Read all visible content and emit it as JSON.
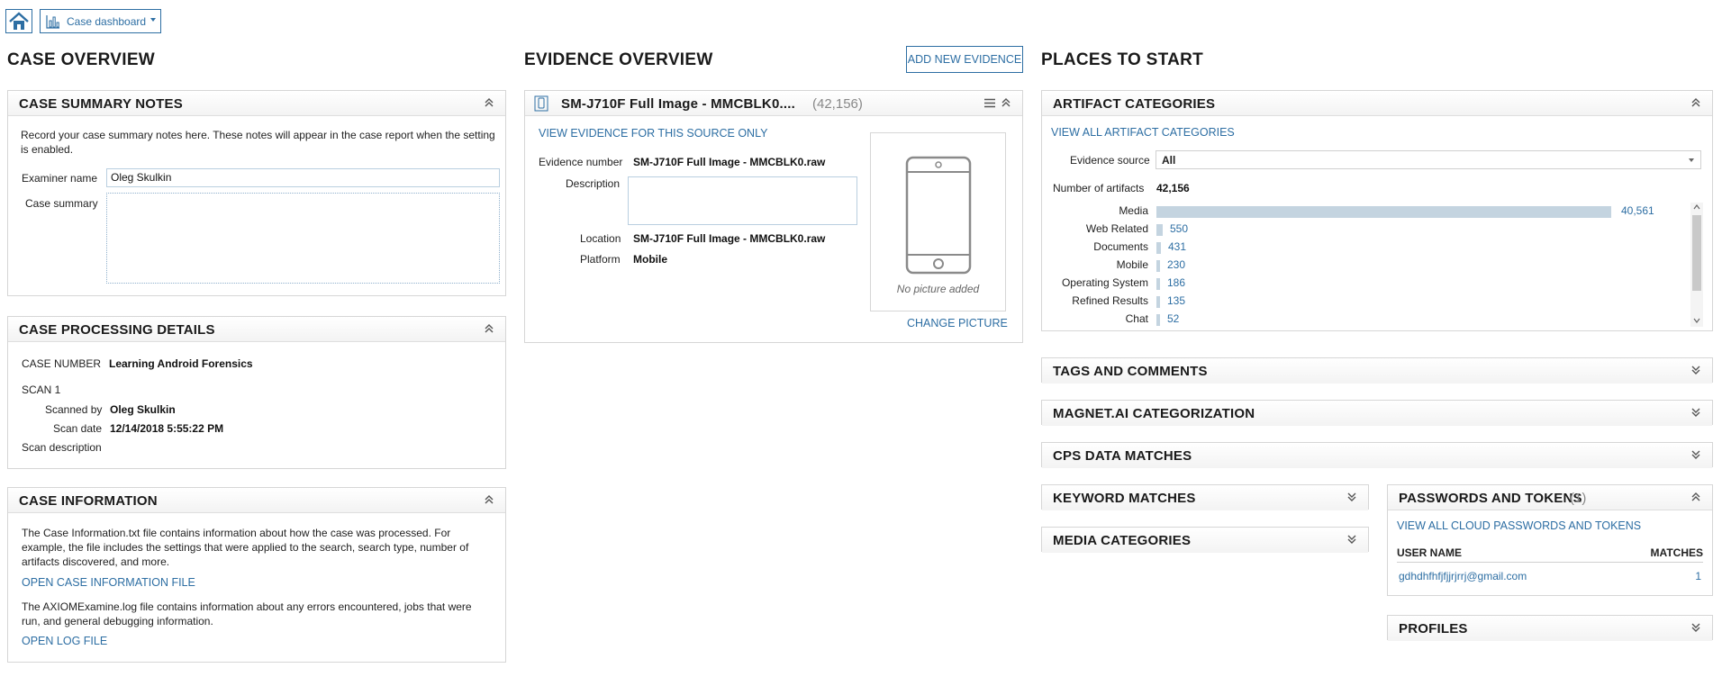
{
  "toolbar": {
    "home_icon": "home-icon",
    "view_selector": {
      "icon": "bar-chart-icon",
      "label": "Case dashboard"
    }
  },
  "case_overview": {
    "title": "CASE OVERVIEW",
    "summary_notes": {
      "title": "CASE SUMMARY NOTES",
      "description": "Record your case summary notes here. These notes will appear in the case report when the setting is enabled.",
      "examiner_label": "Examiner name",
      "examiner_value": "Oleg Skulkin",
      "case_summary_label": "Case summary",
      "case_summary_value": ""
    },
    "processing_details": {
      "title": "CASE PROCESSING DETAILS",
      "case_number_label": "CASE NUMBER",
      "case_number_value": "Learning Android Forensics",
      "scan_heading": "SCAN 1",
      "scanned_by_label": "Scanned by",
      "scanned_by_value": "Oleg Skulkin",
      "scan_date_label": "Scan date",
      "scan_date_value": "12/14/2018 5:55:22 PM",
      "scan_description_label": "Scan description"
    },
    "case_information": {
      "title": "CASE INFORMATION",
      "text1": "The Case Information.txt file contains information about how the case was processed. For example, the file includes the settings that were applied to the search, search type, number of artifacts discovered, and more.",
      "link1": "OPEN CASE INFORMATION FILE",
      "text2": "The AXIOMExamine.log file contains information about any errors encountered, jobs that were run, and general debugging information.",
      "link2": "OPEN LOG FILE"
    }
  },
  "evidence_overview": {
    "title": "EVIDENCE OVERVIEW",
    "add_button": "ADD NEW EVIDENCE",
    "card": {
      "icon": "phone-icon",
      "title": "SM-J710F Full Image - MMCBLK0....",
      "count": "(42,156)",
      "view_link": "VIEW EVIDENCE FOR THIS SOURCE ONLY",
      "evidence_number_label": "Evidence number",
      "evidence_number_value": "SM-J710F Full Image - MMCBLK0.raw",
      "description_label": "Description",
      "description_value": "",
      "location_label": "Location",
      "location_value": "SM-J710F Full Image - MMCBLK0.raw",
      "platform_label": "Platform",
      "platform_value": "Mobile",
      "no_picture": "No picture added",
      "change_picture": "CHANGE PICTURE"
    }
  },
  "places_to_start": {
    "title": "PLACES TO START",
    "artifact_categories": {
      "title": "ARTIFACT CATEGORIES",
      "view_all": "VIEW ALL ARTIFACT CATEGORIES",
      "evidence_source_label": "Evidence source",
      "evidence_source_value": "All",
      "num_artifacts_label": "Number of artifacts",
      "num_artifacts_value": "42,156",
      "categories": [
        {
          "label": "Media",
          "value": 40561,
          "display": "40,561"
        },
        {
          "label": "Web Related",
          "value": 550,
          "display": "550"
        },
        {
          "label": "Documents",
          "value": 431,
          "display": "431"
        },
        {
          "label": "Mobile",
          "value": 230,
          "display": "230"
        },
        {
          "label": "Operating System",
          "value": 186,
          "display": "186"
        },
        {
          "label": "Refined Results",
          "value": 135,
          "display": "135"
        },
        {
          "label": "Chat",
          "value": 52,
          "display": "52"
        }
      ]
    },
    "tags_and_comments": "TAGS AND COMMENTS",
    "magnet_ai": "MAGNET.AI CATEGORIZATION",
    "cps_data": "CPS DATA MATCHES",
    "keyword_matches": "KEYWORD MATCHES",
    "media_categories": "MEDIA CATEGORIES",
    "passwords": {
      "title": "PASSWORDS AND TOKENS",
      "count": "(1)",
      "view_all": "VIEW ALL CLOUD PASSWORDS AND TOKENS",
      "col_user": "USER NAME",
      "col_matches": "MATCHES",
      "rows": [
        {
          "user": "gdhdhfhfjfjjrjrrj@gmail.com",
          "matches": "1"
        }
      ]
    },
    "profiles": "PROFILES"
  },
  "colors": {
    "accent": "#2d6ea3",
    "bar": "#c4d4e0",
    "border": "#d6d6d6"
  }
}
